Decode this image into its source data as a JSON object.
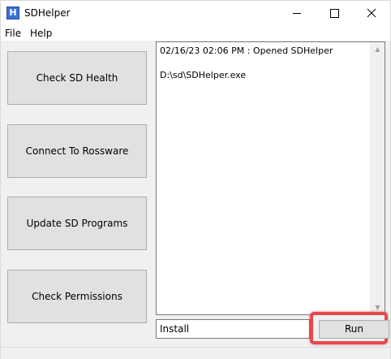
{
  "window": {
    "title": "SDHelper",
    "icon": "app-h-icon",
    "icon_letter": "H"
  },
  "window_controls": {
    "minimize": "minimize-icon",
    "maximize": "maximize-icon",
    "close": "close-icon"
  },
  "menu": {
    "items": [
      {
        "label": "File"
      },
      {
        "label": "Help"
      }
    ]
  },
  "actions": [
    {
      "label": "Check SD Health"
    },
    {
      "label": "Connect To Rossware"
    },
    {
      "label": "Update SD Programs"
    },
    {
      "label": "Check Permissions"
    }
  ],
  "log": {
    "lines": [
      "02/16/23 02:06 PM : Opened SDHelper",
      "D:\\sd\\SDHelper.exe"
    ]
  },
  "command": {
    "value": "Install",
    "run_label": "Run"
  },
  "colors": {
    "highlight": "#e5484d",
    "button_face": "#e1e1e1",
    "window_bg": "#f0f0f0"
  }
}
